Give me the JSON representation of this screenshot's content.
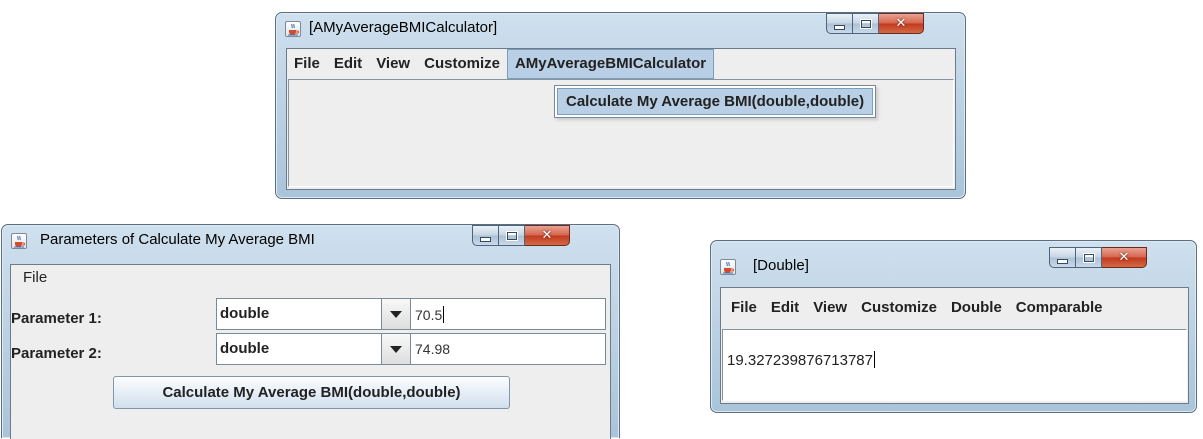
{
  "calculator_window": {
    "title": "[AMyAverageBMICalculator]",
    "menu": [
      "File",
      "Edit",
      "View",
      "Customize",
      "AMyAverageBMICalculator"
    ],
    "popup_item": "Calculate My Average BMI(double,double)"
  },
  "parameters_window": {
    "title": "Parameters of Calculate My Average BMI",
    "menu": [
      "File"
    ],
    "params": [
      {
        "label": "Parameter 1:",
        "type": "double",
        "value": "70.5"
      },
      {
        "label": "Parameter 2:",
        "type": "double",
        "value": "74.98"
      }
    ],
    "button_label": "Calculate My Average BMI(double,double)"
  },
  "result_window": {
    "title": "[Double]",
    "menu": [
      "File",
      "Edit",
      "View",
      "Customize",
      "Double",
      "Comparable"
    ],
    "value": "19.327239876713787"
  },
  "icons": {
    "window_icon": "java-cup-icon",
    "minimize": "minimize-icon",
    "maximize": "maximize-icon",
    "close": "close-icon",
    "dropdown": "chevron-down-icon"
  },
  "colors": {
    "title_bar": "#b9d0e4",
    "menu_highlight": "#b8cfe5",
    "close_button": "#c74a2e",
    "client_bg": "#eeeeee"
  }
}
